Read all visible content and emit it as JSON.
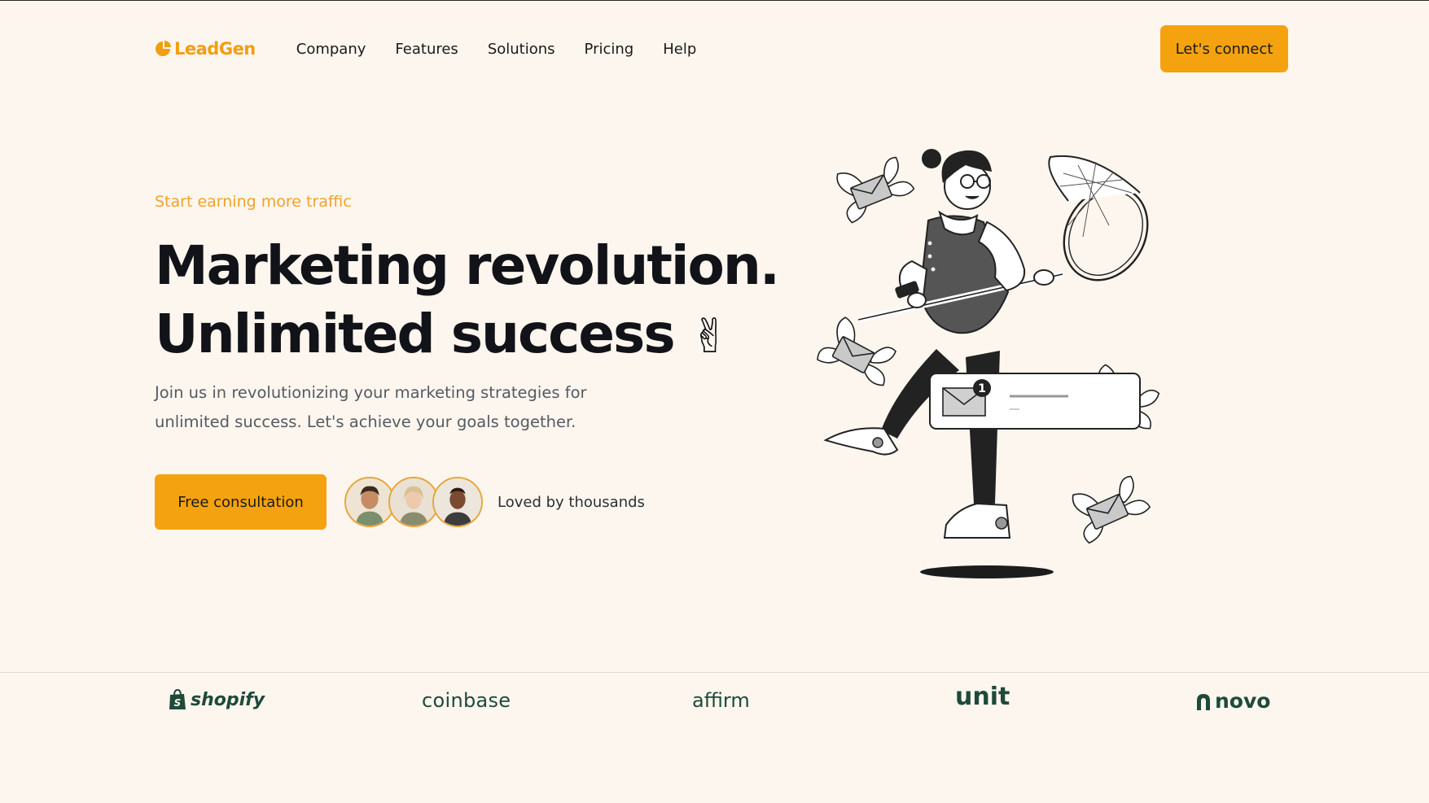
{
  "nav": {
    "logo_text": "LeadGen",
    "menu": [
      "Company",
      "Features",
      "Solutions",
      "Pricing",
      "Help"
    ],
    "cta_label": "Let's connect"
  },
  "hero": {
    "eyebrow": "Start earning more traffic",
    "headline_line1": "Marketing revolution.",
    "headline_line2": "Unlimited success",
    "headline_emoji": "✌",
    "subtext": "Join us in revolutionizing your marketing strategies for unlimited success. Let's achieve your goals together.",
    "cta_label": "Free consultation",
    "social_proof": "Loved by thousands",
    "notification_count": "1"
  },
  "brands": [
    "shopify",
    "coinbase",
    "affirm",
    "unit",
    "novo"
  ],
  "colors": {
    "background": "#fdf6ee",
    "accent": "#f4a20f",
    "eyebrow": "#f0a32a",
    "brand_logo": "#1f4a3a"
  },
  "icons": {
    "logo": "leadgen-logo-icon",
    "shopify": "shopping-bag-icon",
    "novo": "novo-arch-icon"
  }
}
